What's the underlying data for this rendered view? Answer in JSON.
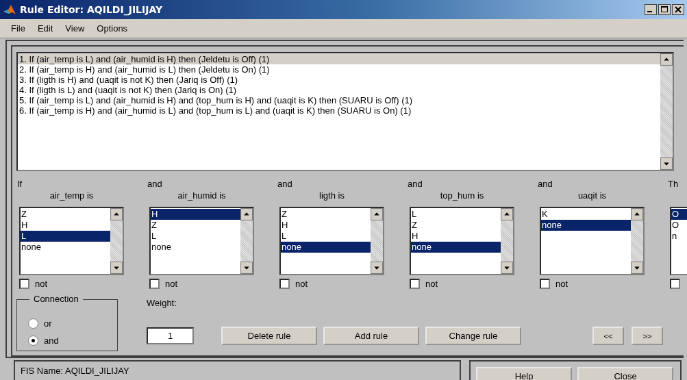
{
  "window": {
    "title": "Rule Editor: AQILDI_JILIJAY"
  },
  "menu": [
    "File",
    "Edit",
    "View",
    "Options"
  ],
  "rules": [
    {
      "text": "1. If (air_temp is L) and (air_humid is H) then (Jeldetu is Off) (1)",
      "selected": true
    },
    {
      "text": "2. If (air_temp is H) and (air_humid is L) then (Jeldetu is On) (1)",
      "selected": false
    },
    {
      "text": "3. If (ligth is H) and (uaqit is not K) then (Jariq is Off) (1)",
      "selected": false
    },
    {
      "text": "4. If (ligth is L) and (uaqit is not K) then (Jariq is On) (1)",
      "selected": false
    },
    {
      "text": "5. If (air_temp is L) and (air_humid is H) and (top_hum is H) and (uaqit is K) then (SUARU is Off) (1)",
      "selected": false
    },
    {
      "text": "6. If (air_temp is H) and (air_humid is L) and (top_hum is L) and (uaqit is K) then (SUARU is On) (1)",
      "selected": false
    }
  ],
  "columns": [
    {
      "kind": "input",
      "connector": "If",
      "label": "air_temp is",
      "items": [
        {
          "text": "Z",
          "selected": false
        },
        {
          "text": "H",
          "selected": false
        },
        {
          "text": "L",
          "selected": true
        },
        {
          "text": "none",
          "selected": false
        }
      ],
      "not_label": "not",
      "not_checked": false
    },
    {
      "kind": "input",
      "connector": "and",
      "label": "air_humid is",
      "items": [
        {
          "text": "H",
          "selected": true
        },
        {
          "text": "Z",
          "selected": false
        },
        {
          "text": "L",
          "selected": false
        },
        {
          "text": "none",
          "selected": false
        }
      ],
      "not_label": "not",
      "not_checked": false
    },
    {
      "kind": "input",
      "connector": "and",
      "label": "ligth is",
      "items": [
        {
          "text": "Z",
          "selected": false
        },
        {
          "text": "H",
          "selected": false
        },
        {
          "text": "L",
          "selected": false
        },
        {
          "text": "none",
          "selected": true
        }
      ],
      "not_label": "not",
      "not_checked": false
    },
    {
      "kind": "input",
      "connector": "and",
      "label": "top_hum is",
      "items": [
        {
          "text": "L",
          "selected": false
        },
        {
          "text": "Z",
          "selected": false
        },
        {
          "text": "H",
          "selected": false
        },
        {
          "text": "none",
          "selected": true
        }
      ],
      "not_label": "not",
      "not_checked": false
    },
    {
      "kind": "input",
      "connector": "and",
      "label": "uaqit is",
      "items": [
        {
          "text": "K",
          "selected": false
        },
        {
          "text": "none",
          "selected": true
        }
      ],
      "not_label": "not",
      "not_checked": false
    },
    {
      "kind": "cut",
      "connector": "Th",
      "items": [
        {
          "text": "O",
          "selected": true
        },
        {
          "text": "O",
          "selected": false
        },
        {
          "text": "n",
          "selected": false
        }
      ],
      "not_checked": false
    }
  ],
  "connection": {
    "title": "Connection",
    "options": [
      {
        "label": "or",
        "selected": false
      },
      {
        "label": "and",
        "selected": true
      }
    ]
  },
  "weight": {
    "label": "Weight:",
    "value": "1"
  },
  "rule_buttons": [
    "Delete rule",
    "Add rule",
    "Change rule"
  ],
  "nav_buttons": [
    "<<",
    ">>"
  ],
  "status": "FIS Name: AQILDI_JILIJAY",
  "bottom_buttons": [
    "Help",
    "Close"
  ]
}
